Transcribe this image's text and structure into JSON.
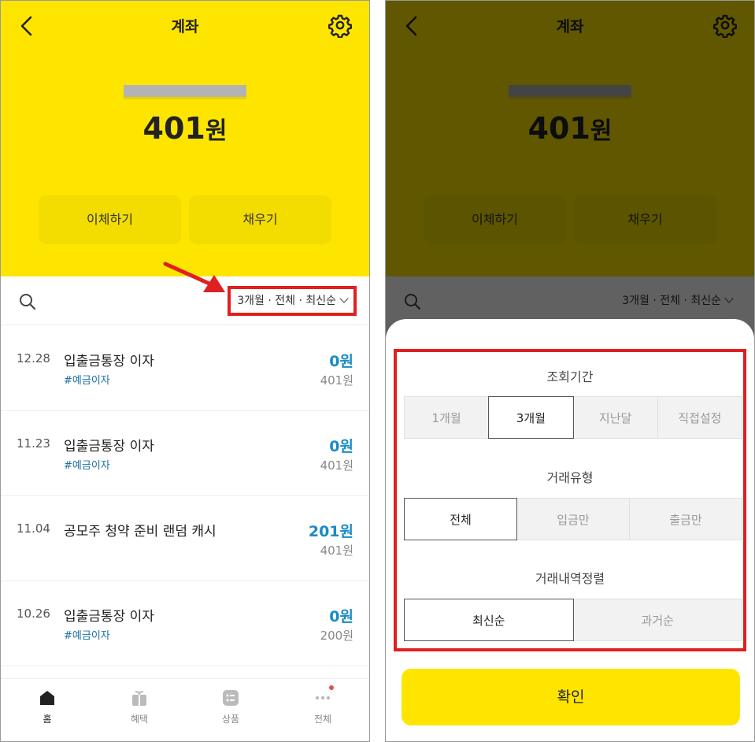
{
  "header": {
    "title": "계좌",
    "balance_number": "401",
    "balance_unit": "원"
  },
  "actions": {
    "transfer": "이체하기",
    "fill": "채우기"
  },
  "filter": {
    "label": "3개월 · 전체 · 최신순"
  },
  "transactions": [
    {
      "date": "12.28",
      "desc": "입출금통장 이자",
      "tag": "#예금이자",
      "amount": "0원",
      "balance": "401원"
    },
    {
      "date": "11.23",
      "desc": "입출금통장 이자",
      "tag": "#예금이자",
      "amount": "0원",
      "balance": "401원"
    },
    {
      "date": "11.04",
      "desc": "공모주 청약 준비 랜덤 캐시",
      "tag": "",
      "amount": "201원",
      "balance": "401원"
    },
    {
      "date": "10.26",
      "desc": "입출금통장 이자",
      "tag": "#예금이자",
      "amount": "0원",
      "balance": "200원"
    }
  ],
  "nav": [
    {
      "label": "홈",
      "icon": "home-icon",
      "active": true
    },
    {
      "label": "혜택",
      "icon": "gift-icon",
      "active": false
    },
    {
      "label": "상품",
      "icon": "list-icon",
      "active": false
    },
    {
      "label": "전체",
      "icon": "more-icon",
      "active": false
    }
  ],
  "sheet": {
    "period_title": "조회기간",
    "period_options": [
      "1개월",
      "3개월",
      "지난달",
      "직접설정"
    ],
    "period_selected": "3개월",
    "type_title": "거래유형",
    "type_options": [
      "전체",
      "입금만",
      "출금만"
    ],
    "type_selected": "전체",
    "sort_title": "거래내역정렬",
    "sort_options": [
      "최신순",
      "과거순"
    ],
    "sort_selected": "최신순",
    "confirm": "확인"
  },
  "colors": {
    "brand_yellow": "#fee500",
    "accent_blue": "#1a8bc4",
    "highlight_red": "#e02020"
  }
}
